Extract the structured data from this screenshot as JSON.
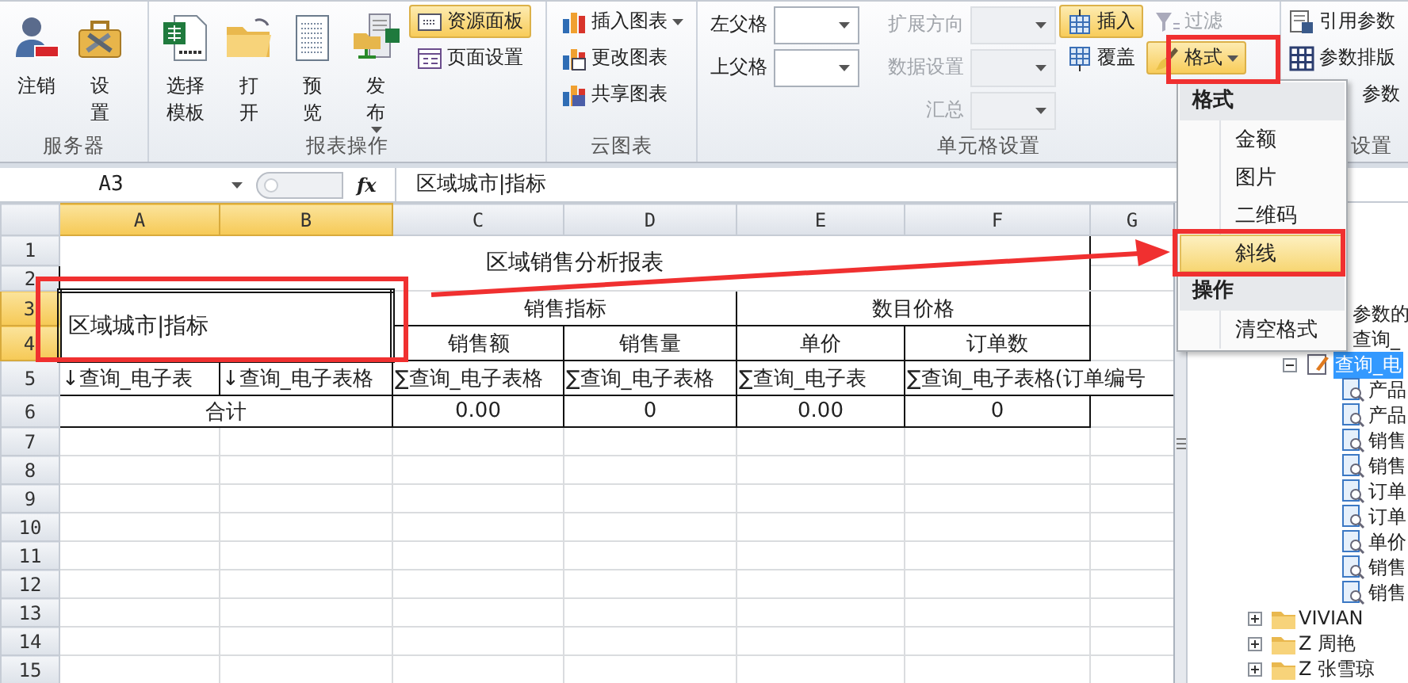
{
  "ribbon": {
    "groups": [
      {
        "label": "服务器",
        "columns": [
          [
            {
              "kind": "large",
              "lines": [
                "注销"
              ]
            }
          ],
          [
            {
              "kind": "large",
              "lines": [
                "设",
                "置"
              ]
            }
          ]
        ]
      },
      {
        "label": "报表操作",
        "columns": [
          [
            {
              "kind": "large",
              "lines": [
                "选择",
                "模板"
              ]
            }
          ],
          [
            {
              "kind": "large",
              "lines": [
                "打",
                "开"
              ]
            }
          ],
          [
            {
              "kind": "large",
              "lines": [
                "预",
                "览"
              ]
            }
          ],
          [
            {
              "kind": "large",
              "lines": [
                "发",
                "布"
              ],
              "dropdown": true
            }
          ],
          [
            {
              "kind": "small",
              "label": "资源面板",
              "selected": true
            },
            {
              "kind": "small",
              "label": "页面设置",
              "selected": false
            }
          ]
        ]
      },
      {
        "label": "云图表",
        "columns": [
          [
            {
              "kind": "small",
              "label": "插入图表",
              "selected": false,
              "dropdown": true
            },
            {
              "kind": "small",
              "label": "更改图表",
              "selected": false
            },
            {
              "kind": "small",
              "label": "共享图表",
              "selected": false
            }
          ]
        ]
      },
      {
        "label": "单元格设置",
        "columns": [
          [
            {
              "kind": "combo",
              "label": "左父格",
              "disabled": false
            },
            {
              "kind": "combo",
              "label": "上父格",
              "disabled": false
            }
          ],
          [
            {
              "kind": "combo",
              "label": "扩展方向",
              "disabled": true
            },
            {
              "kind": "combo",
              "label": "数据设置",
              "disabled": true
            },
            {
              "kind": "combo",
              "label": "汇总",
              "disabled": true
            }
          ],
          [
            {
              "kind": "small",
              "label": "插入",
              "selected": true,
              "disabled": false
            },
            {
              "kind": "small",
              "label": "覆盖",
              "selected": false,
              "disabled": false
            }
          ],
          [
            {
              "kind": "small",
              "label": "过滤",
              "selected": false,
              "disabled": true
            },
            {
              "kind": "small",
              "label": "格式",
              "selected": true,
              "disabled": false,
              "dropdown": true
            }
          ]
        ]
      },
      {
        "label": "设置",
        "columns": [
          [
            {
              "kind": "small",
              "label": "引用参数",
              "selected": false
            },
            {
              "kind": "small",
              "label": "参数排版",
              "selected": false
            },
            {
              "kind": "small",
              "label": "参数",
              "selected": false
            }
          ]
        ]
      }
    ]
  },
  "format_menu": {
    "sections": [
      {
        "header": "格式",
        "items": [
          {
            "label": "金额",
            "highlighted": false
          },
          {
            "label": "图片",
            "highlighted": false
          },
          {
            "label": "二维码",
            "highlighted": false
          },
          {
            "label": "斜线",
            "highlighted": true
          }
        ]
      },
      {
        "header": "操作",
        "items": [
          {
            "label": "清空格式",
            "highlighted": false
          }
        ]
      }
    ]
  },
  "formula_bar": {
    "cell_reference": "A3",
    "function_label": "fx",
    "formula": "区域城市|指标"
  },
  "sheet": {
    "columns": [
      {
        "label": "A",
        "selected": true
      },
      {
        "label": "B",
        "selected": true
      },
      {
        "label": "C",
        "selected": false
      },
      {
        "label": "D",
        "selected": false
      },
      {
        "label": "E",
        "selected": false
      },
      {
        "label": "F",
        "selected": false
      },
      {
        "label": "G",
        "selected": false
      }
    ],
    "row_headers": [
      {
        "label": "1",
        "selected": false
      },
      {
        "label": "2",
        "selected": false
      },
      {
        "label": "3",
        "selected": true
      },
      {
        "label": "4",
        "selected": true
      },
      {
        "label": "5",
        "selected": false
      },
      {
        "label": "6",
        "selected": false
      },
      {
        "label": "7",
        "selected": false
      },
      {
        "label": "8",
        "selected": false
      },
      {
        "label": "9",
        "selected": false
      },
      {
        "label": "10",
        "selected": false
      },
      {
        "label": "11",
        "selected": false
      },
      {
        "label": "12",
        "selected": false
      },
      {
        "label": "13",
        "selected": false
      },
      {
        "label": "14",
        "selected": false
      },
      {
        "label": "15",
        "selected": false
      }
    ],
    "title": "区域销售分析报表",
    "corner_cell": "区域城市|指标",
    "group_headers": [
      "销售指标",
      "数目价格"
    ],
    "metric_headers": [
      "销售额",
      "销售量",
      "单价",
      "订单数"
    ],
    "field_cells": [
      "↓查询_电子表",
      "↓查询_电子表格",
      "∑查询_电子表格",
      "∑查询_电子表格",
      "∑查询_电子表",
      "∑查询_电子表格(订单编号"
    ],
    "total_label": "合计",
    "totals": [
      "0.00",
      "0",
      "0.00",
      "0"
    ]
  },
  "resource_tree": {
    "items": [
      {
        "children": [
          {
            "label": "参数的",
            "selected": false
          },
          {
            "label": "查询_",
            "selected": false
          },
          {
            "kind": "query",
            "label": "查询_电",
            "selected": true,
            "expanded": true,
            "children": [
              {
                "kind": "field",
                "label": "产品",
                "selected": false
              },
              {
                "kind": "field",
                "label": "产品",
                "selected": false
              },
              {
                "kind": "field",
                "label": "销售",
                "selected": false
              },
              {
                "kind": "field",
                "label": "销售",
                "selected": false
              },
              {
                "kind": "field",
                "label": "订单",
                "selected": false
              },
              {
                "kind": "field",
                "label": "订单",
                "selected": false
              },
              {
                "kind": "field",
                "label": "单价",
                "selected": false
              },
              {
                "kind": "field",
                "label": "销售",
                "selected": false
              },
              {
                "kind": "field",
                "label": "销售",
                "selected": false
              }
            ]
          }
        ]
      },
      {
        "kind": "folder",
        "label": "VIVIAN",
        "selected": false,
        "expanded": false
      },
      {
        "kind": "folder",
        "label": "Z 周艳",
        "selected": false,
        "expanded": false
      },
      {
        "kind": "folder",
        "label": "Z 张雪琼",
        "selected": false,
        "expanded": false
      }
    ]
  }
}
